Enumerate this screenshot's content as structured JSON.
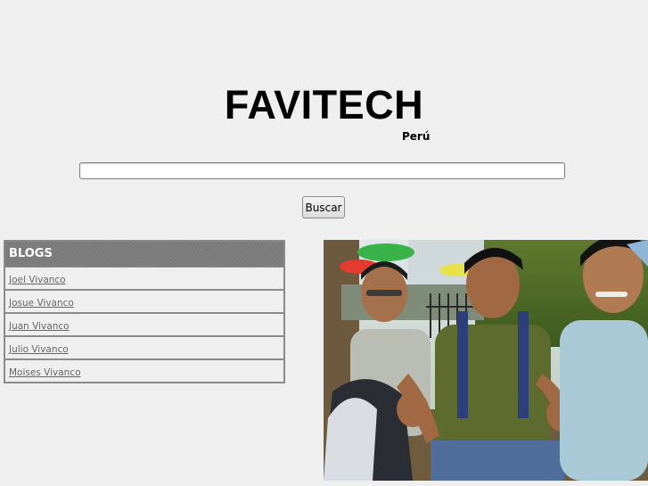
{
  "header": {
    "logo": "FAVITECH",
    "tagline": "Perú"
  },
  "search": {
    "value": "",
    "placeholder": "",
    "button_label": "Buscar"
  },
  "blogs": {
    "title": "BLOGS",
    "items": [
      {
        "label": "Joel Vivanco"
      },
      {
        "label": "Josue Vivanco"
      },
      {
        "label": "Juan Vivanco"
      },
      {
        "label": "Julio Vivanco"
      },
      {
        "label": "Moises Vivanco"
      }
    ]
  },
  "photo": {
    "subject": "group-photo-three-young-men-thumbs-up"
  },
  "colors": {
    "background": "#efefef",
    "box_border": "#8a8a8a",
    "box_header": "#7a7a7a",
    "link": "#666666"
  }
}
